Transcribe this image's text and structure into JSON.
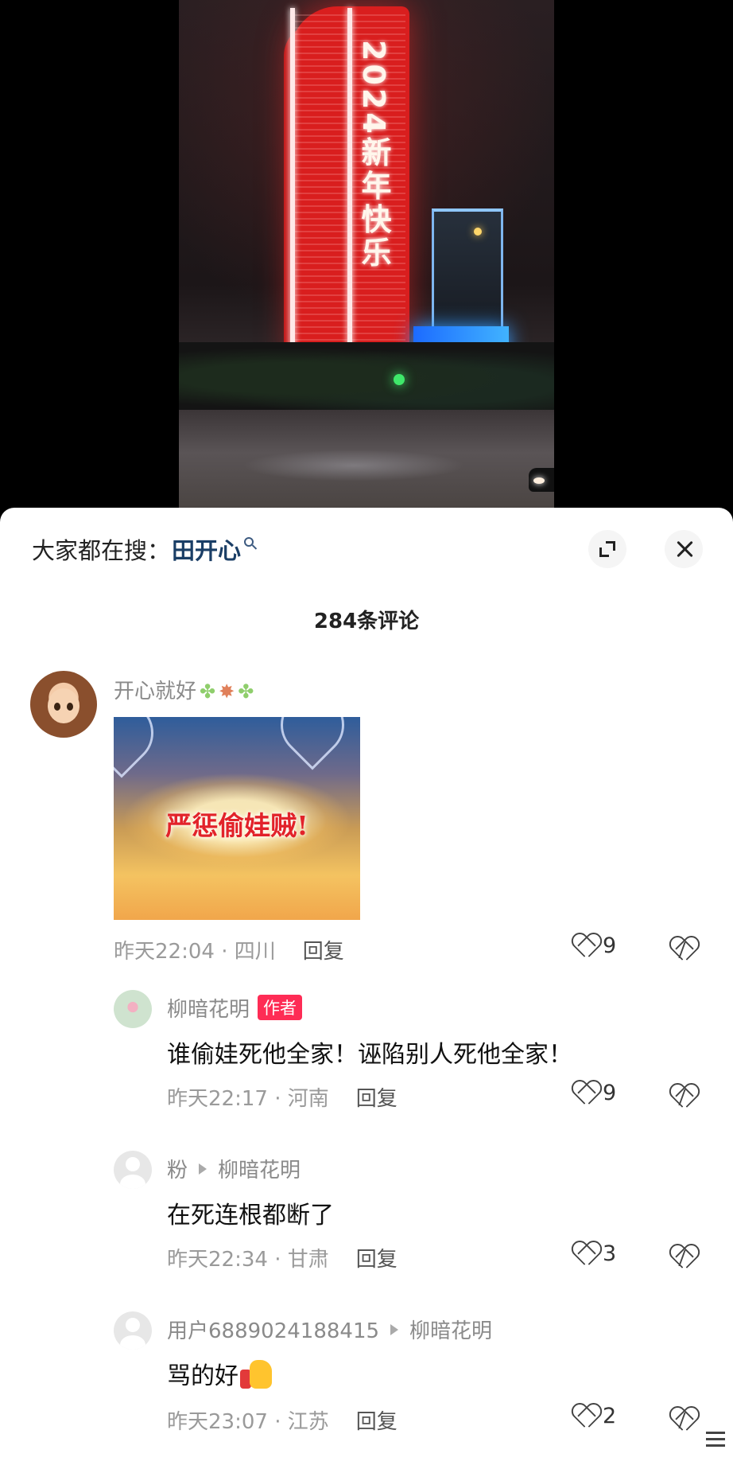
{
  "video": {
    "tower_text": "2024新年快乐"
  },
  "header": {
    "search_label": "大家都在搜：",
    "search_term": "田开心",
    "comment_count": "284条评论"
  },
  "comments": [
    {
      "user": "开心就好",
      "image_caption": "严惩偷娃贼!",
      "time": "昨天22:04",
      "location": "四川",
      "reply": "回复",
      "likes": "9"
    },
    {
      "user": "柳暗花明",
      "badge": "作者",
      "text": "谁偷娃死他全家！诬陷别人死他全家！",
      "time": "昨天22:17",
      "location": "河南",
      "reply": "回复",
      "likes": "9"
    },
    {
      "user": "粉",
      "reply_to": "柳暗花明",
      "text": "在死连根都断了",
      "time": "昨天22:34",
      "location": "甘肃",
      "reply": "回复",
      "likes": "3"
    },
    {
      "user": "用户6889024188415",
      "reply_to": "柳暗花明",
      "text": "骂的好",
      "time": "昨天23:07",
      "location": "江苏",
      "reply": "回复",
      "likes": "2"
    }
  ],
  "colors": {
    "badge": "#fe2c55",
    "search_term": "#1a3e66",
    "tower": "#d91e1e"
  }
}
